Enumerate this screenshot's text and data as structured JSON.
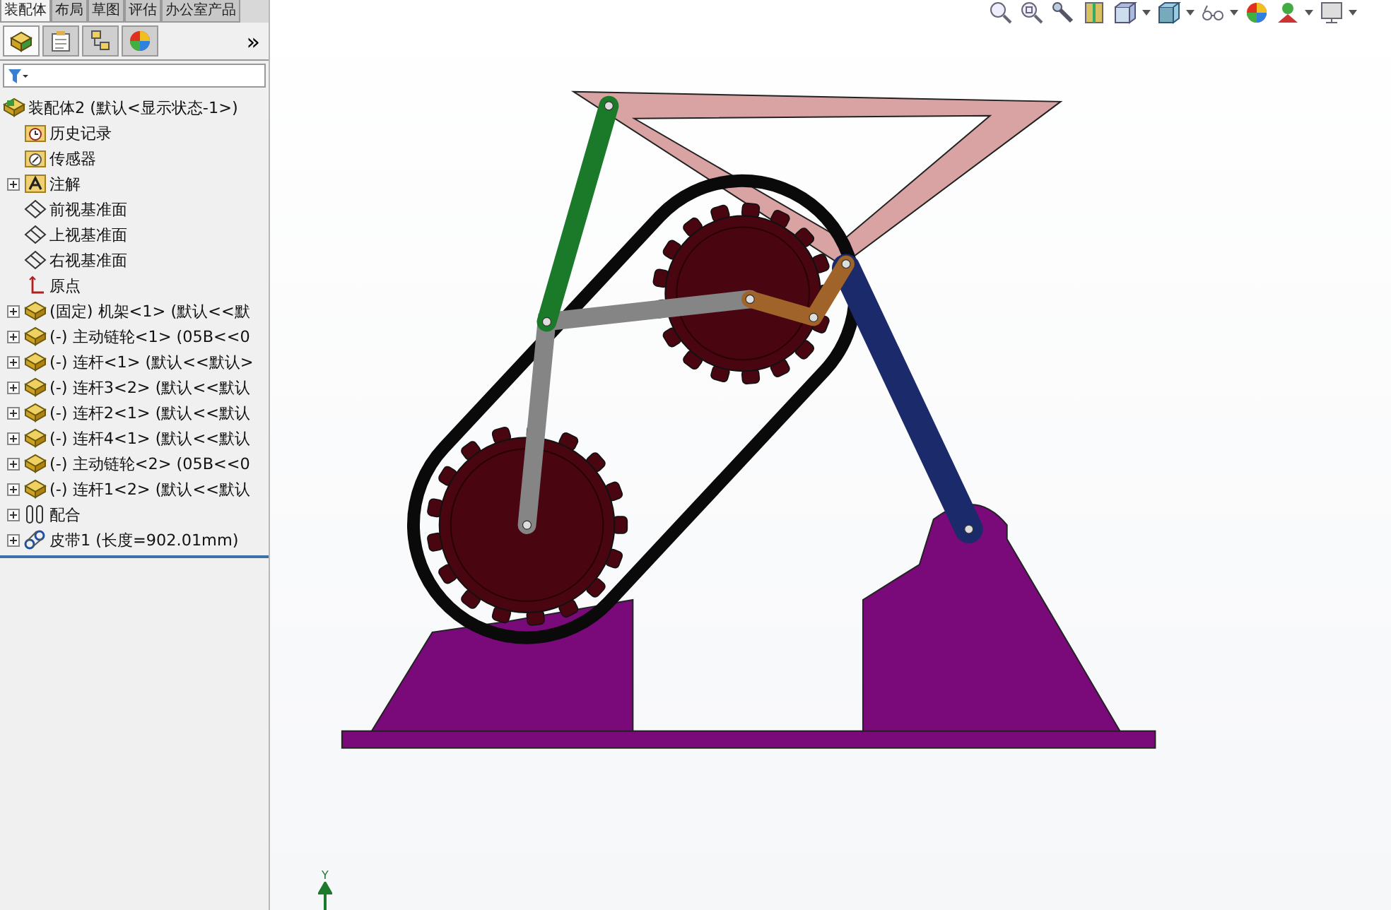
{
  "command_tabs": [
    {
      "label": "装配体",
      "selected": true
    },
    {
      "label": "布局",
      "selected": false
    },
    {
      "label": "草图",
      "selected": false
    },
    {
      "label": "评估",
      "selected": false
    },
    {
      "label": "办公室产品",
      "selected": false
    }
  ],
  "manager_tabs": [
    {
      "kind": "feature",
      "selected": true
    },
    {
      "kind": "property",
      "selected": false
    },
    {
      "kind": "config",
      "selected": false
    },
    {
      "kind": "appearance",
      "selected": false
    }
  ],
  "more_button": "»",
  "tree": {
    "label": "装配体2  (默认<显示状态-1>)",
    "kind": "assembly",
    "children": [
      {
        "label": "历史记录",
        "kind": "history",
        "expandable": false
      },
      {
        "label": "传感器",
        "kind": "sensor",
        "expandable": false
      },
      {
        "label": "注解",
        "kind": "annotation",
        "expandable": true
      },
      {
        "label": "前视基准面",
        "kind": "plane",
        "expandable": false
      },
      {
        "label": "上视基准面",
        "kind": "plane",
        "expandable": false
      },
      {
        "label": "右视基准面",
        "kind": "plane",
        "expandable": false
      },
      {
        "label": "原点",
        "kind": "origin",
        "expandable": false
      },
      {
        "label": "(固定) 机架<1> (默认<<默",
        "kind": "part",
        "expandable": true
      },
      {
        "label": "(-) 主动链轮<1> (05B<<0",
        "kind": "part",
        "expandable": true
      },
      {
        "label": "(-) 连杆<1> (默认<<默认>",
        "kind": "part",
        "expandable": true
      },
      {
        "label": "(-) 连杆3<2> (默认<<默认",
        "kind": "part",
        "expandable": true
      },
      {
        "label": "(-) 连杆2<1> (默认<<默认",
        "kind": "part",
        "expandable": true
      },
      {
        "label": "(-) 连杆4<1> (默认<<默认",
        "kind": "part",
        "expandable": true
      },
      {
        "label": "(-) 主动链轮<2> (05B<<0",
        "kind": "part",
        "expandable": true
      },
      {
        "label": "(-) 连杆1<2> (默认<<默认",
        "kind": "part",
        "expandable": true
      },
      {
        "label": "配合",
        "kind": "mates",
        "expandable": true
      },
      {
        "label": "皮带1 (长度=902.01mm)",
        "kind": "belt",
        "expandable": true
      }
    ]
  },
  "view_toolbar": [
    {
      "kind": "zoom-fit",
      "dropdown": false
    },
    {
      "kind": "zoom-area",
      "dropdown": false
    },
    {
      "kind": "previous-view",
      "dropdown": false
    },
    {
      "kind": "section",
      "dropdown": false
    },
    {
      "kind": "orientation",
      "dropdown": true
    },
    {
      "kind": "display-style",
      "dropdown": true
    },
    {
      "kind": "hide-show",
      "dropdown": true
    },
    {
      "kind": "appearance",
      "dropdown": false
    },
    {
      "kind": "scene",
      "dropdown": true
    },
    {
      "kind": "view-settings",
      "dropdown": true
    }
  ],
  "triad": {
    "axis_label": "Y"
  }
}
